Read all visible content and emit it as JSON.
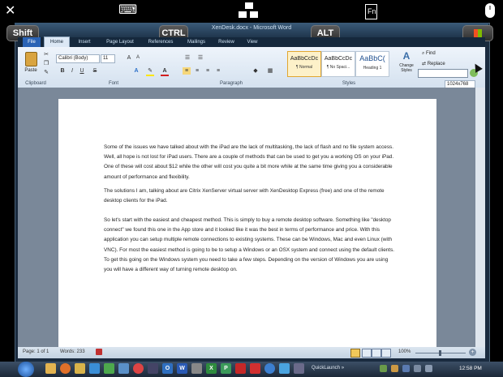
{
  "overlay": {
    "close_glyph": "✕",
    "keyboard_glyph": "⌨",
    "fn_label": "Fn",
    "shift_label": "Shift",
    "ctrl_label": "CTRL",
    "alt_label": "ALT"
  },
  "window": {
    "title": "XenDesk.docx - Microsoft Word"
  },
  "tabs": [
    "File",
    "Home",
    "Insert",
    "Page Layout",
    "References",
    "Mailings",
    "Review",
    "View"
  ],
  "ribbon": {
    "paste_label": "Paste",
    "font_name": "Calibri (Body)",
    "font_size": "11",
    "styles": [
      {
        "sample": "AaBbCcDc",
        "name": "¶ Normal"
      },
      {
        "sample": "AaBbCcDc",
        "name": "¶ No Spaci..."
      },
      {
        "sample": "AaBbC(",
        "name": "Heading 1"
      }
    ],
    "change_styles_label": "Change Styles",
    "find_label": "Find",
    "replace_label": "Replace",
    "resolution_label": "1024x768",
    "groups": {
      "clipboard": "Clipboard",
      "font": "Font",
      "paragraph": "Paragraph",
      "styles": "Styles"
    }
  },
  "document": {
    "paragraphs": [
      "Some of the issues we have talked about with the iPad are the lack of multitasking, the lack of flash and no file system access. Well, all hope is not lost for iPad users. There are a couple of methods that can be used to get you a working OS on your iPad. One of these will cost about $12 while the other will cost you quite a bit more while at the same time giving you a considerable amount of performance and flexibility.",
      "The solutions I am, talking about are Citrix XenServer virtual server with XenDesktop Express (free) and one of the remote desktop clients for the iPad.",
      "So let's start with the easiest and cheapest method. This is simply to buy a remote desktop software. Something like \"desktop connect\" we found this one in the App store and it looked like it was the best in terms of performance and price. With this application you can setup multiple remote connections to existing systems. These can be Windows, Mac and even Linux (with VNC). For most the easiest method is going to be to setup a Windows or an OSX system and connect using the default clients. To get this going on the Windows system you need to take a few steps. Depending on the version of Windows you are using you will have a different way of turning remote desktop on."
    ]
  },
  "status": {
    "page": "Page: 1 of 1",
    "words": "Words: 233",
    "zoom": "100%"
  },
  "taskbar": {
    "quicklaunch_label": "QuickLaunch",
    "clock": "12:58 PM"
  }
}
